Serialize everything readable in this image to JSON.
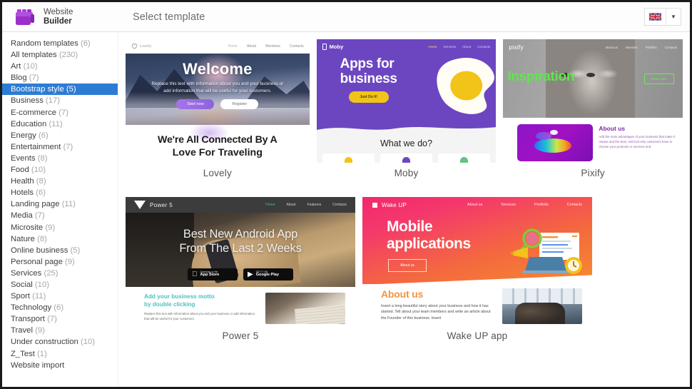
{
  "header": {
    "brand_line1": "Website",
    "brand_line2": "Builder",
    "logo_icon": "blocks-logo-icon",
    "page_title": "Select template",
    "language_flag": "uk-flag-icon",
    "language_caret": "▼"
  },
  "sidebar": {
    "items": [
      {
        "label": "Random templates",
        "count": "(6)",
        "active": false
      },
      {
        "label": "All templates",
        "count": "(230)",
        "active": false
      },
      {
        "label": "Art",
        "count": "(10)",
        "active": false
      },
      {
        "label": "Blog",
        "count": "(7)",
        "active": false
      },
      {
        "label": "Bootstrap style (5)",
        "count": "",
        "active": true
      },
      {
        "label": "Business",
        "count": "(17)",
        "active": false
      },
      {
        "label": "E-commerce",
        "count": "(7)",
        "active": false
      },
      {
        "label": "Education",
        "count": "(11)",
        "active": false
      },
      {
        "label": "Energy",
        "count": "(6)",
        "active": false
      },
      {
        "label": "Entertainment",
        "count": "(7)",
        "active": false
      },
      {
        "label": "Events",
        "count": "(8)",
        "active": false
      },
      {
        "label": "Food",
        "count": "(10)",
        "active": false
      },
      {
        "label": "Health",
        "count": "(8)",
        "active": false
      },
      {
        "label": "Hotels",
        "count": "(6)",
        "active": false
      },
      {
        "label": "Landing page",
        "count": "(11)",
        "active": false
      },
      {
        "label": "Media",
        "count": "(7)",
        "active": false
      },
      {
        "label": "Microsite",
        "count": "(9)",
        "active": false
      },
      {
        "label": "Nature",
        "count": "(8)",
        "active": false
      },
      {
        "label": "Online business",
        "count": "(5)",
        "active": false
      },
      {
        "label": "Personal page",
        "count": "(9)",
        "active": false
      },
      {
        "label": "Services",
        "count": "(25)",
        "active": false
      },
      {
        "label": "Social",
        "count": "(10)",
        "active": false
      },
      {
        "label": "Sport",
        "count": "(11)",
        "active": false
      },
      {
        "label": "Technology",
        "count": "(6)",
        "active": false
      },
      {
        "label": "Transport",
        "count": "(7)",
        "active": false
      },
      {
        "label": "Travel",
        "count": "(9)",
        "active": false
      },
      {
        "label": "Under construction",
        "count": "(10)",
        "active": false
      },
      {
        "label": "Z_Test",
        "count": "(1)",
        "active": false
      },
      {
        "label": "Website import",
        "count": "",
        "active": false
      }
    ]
  },
  "templates": {
    "lovely": {
      "name": "Lovely",
      "logo": "Lovely",
      "logo_icon": "heart-icon",
      "nav": [
        "Home",
        "About",
        "Members",
        "Contacts"
      ],
      "hero_title": "Welcome",
      "hero_sub": "Replace this text with information about you and your business or add information that will be useful for your customers.",
      "btn_primary": "Start now",
      "btn_secondary": "Register",
      "section_title_line1": "We're All Connected By A",
      "section_title_line2": "Love For Traveling"
    },
    "moby": {
      "name": "Moby",
      "logo": "Moby",
      "logo_icon": "phone-icon",
      "nav": [
        "Home",
        "Services",
        "About",
        "Contacts"
      ],
      "hero_title_line1": "Apps for",
      "hero_title_line2": "business",
      "cta": "Just Do It!",
      "section_title": "What we do?"
    },
    "pixify": {
      "name": "Pixify",
      "logo": "pixify",
      "nav": [
        "About us",
        "Services",
        "Portfolio",
        "Contacts"
      ],
      "hero_title": "Inspiration",
      "cta": "Read more",
      "about_title": "About us",
      "about_text": "Add the main advantages of your business that make it unique and the best. Add text why customers have to choose your products or services and"
    },
    "power5": {
      "name": "Power 5",
      "logo": "Power 5",
      "logo_icon": "triangle-icon",
      "nav": [
        "Home",
        "About",
        "Features",
        "Contacts"
      ],
      "hero_title_line1": "Best New Android App",
      "hero_title_line2": "From The Last 2 Weeks",
      "store_apple_small": "Download on the",
      "store_apple_big": "App Store",
      "store_apple_icon": "apple-icon",
      "store_google_small": "GET IT ON",
      "store_google_big": "Google Play",
      "store_google_icon": "play-triangle-icon",
      "motto_line1": "Add your business motto",
      "motto_line2": "by double clicking",
      "motto_text": "Replace this text with information about you and your business or add information that will be useful for your customers."
    },
    "wakeup": {
      "name": "Wake UP app",
      "logo": "Wake UP",
      "logo_icon": "square-icon",
      "nav": [
        "About us",
        "Services",
        "Portfolio",
        "Contacts"
      ],
      "hero_title_line1": "Mobile",
      "hero_title_line2": "applications",
      "cta": "About us",
      "about_title": "About us",
      "about_text": "Insert a long beautiful story about your business and how it has started. Tell about your team members and write an article about the Founder of this business. Insert"
    }
  },
  "colors": {
    "sidebar_active": "#2d7cd4",
    "brand_purple": "#9b30c9",
    "moby_purple": "#6c46c0",
    "moby_yellow": "#f2c319",
    "pixify_green": "#5ee84a",
    "power_teal": "#4ec0c0",
    "wake_pink": "#f2296b",
    "wake_orange": "#f68a2e"
  }
}
